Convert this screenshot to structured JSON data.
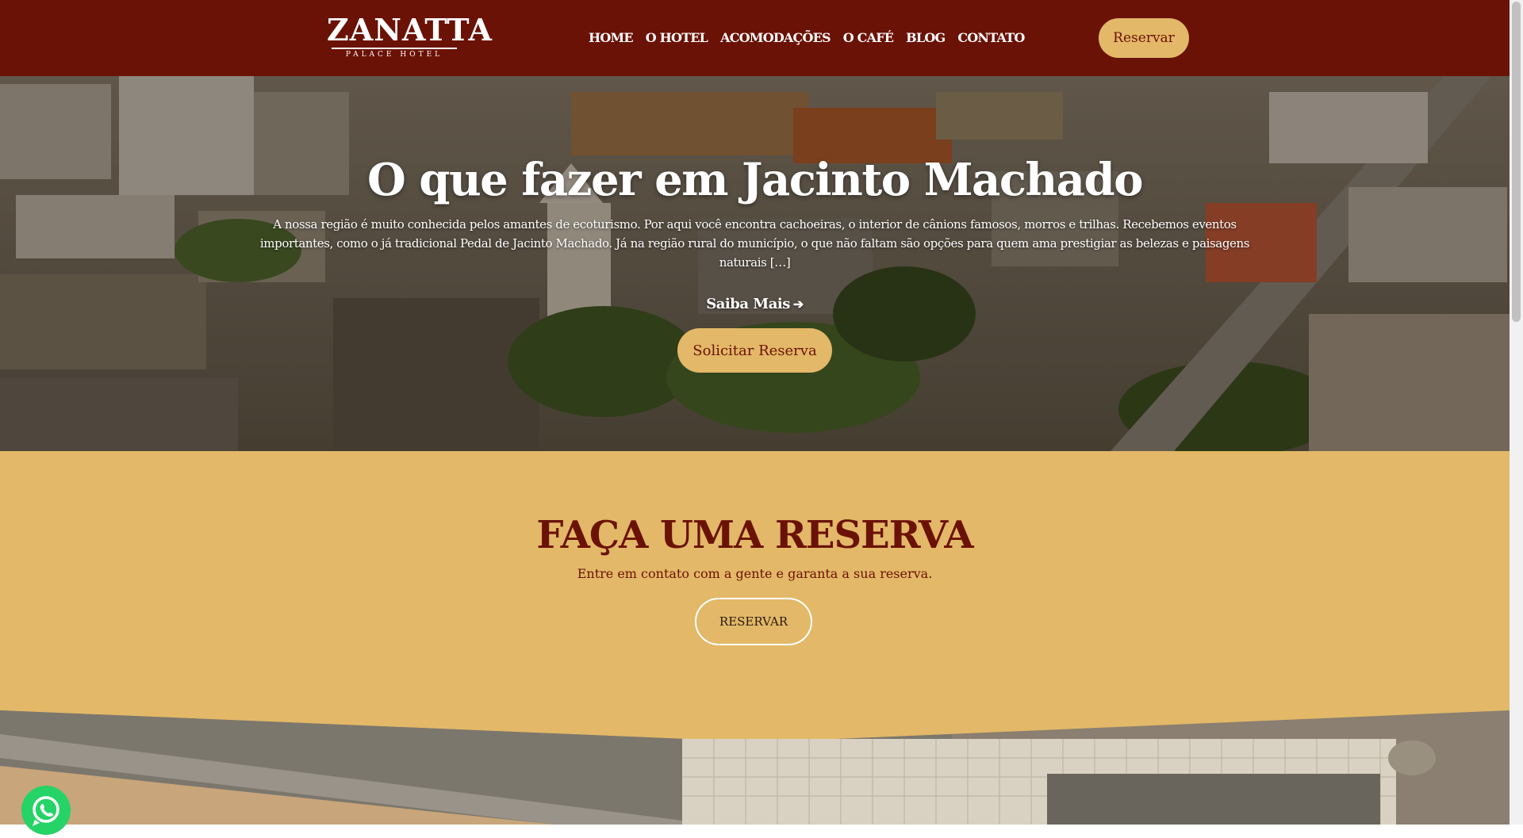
{
  "header": {
    "logo": {
      "main": "ZANATTA",
      "sub": "PALACE HOTEL"
    },
    "nav": [
      "HOME",
      "O HOTEL",
      "ACOMODAÇÕES",
      "O CAFÉ",
      "BLOG",
      "CONTATO"
    ],
    "cta_label": "Reservar"
  },
  "hero": {
    "title": "O que fazer em Jacinto Machado",
    "text": "A nossa região é muito conhecida pelos amantes de ecoturismo. Por aqui você encontra cachoeiras, o interior de cânions famosos, morros e trilhas. Recebemos eventos importantes, como o já tradicional Pedal de Jacinto Machado. Já na região rural do município, o que não faltam são opções para quem ama prestigiar as belezas e paisagens naturais […]",
    "read_more_label": "Saiba Mais",
    "read_more_icon": "arrow-right-icon",
    "button_label": "Solicitar Reserva"
  },
  "reserva": {
    "title": "FAÇA UMA RESERVA",
    "subtitle": "Entre em contato com a gente e garanta a sua reserva.",
    "button_label": "RESERVAR"
  },
  "floating": {
    "icon": "whatsapp-icon"
  },
  "colors": {
    "header_bg": "#6b1206",
    "accent_gold": "#e3b868",
    "brand_red": "#6b1206",
    "whatsapp_green": "#25d366"
  }
}
